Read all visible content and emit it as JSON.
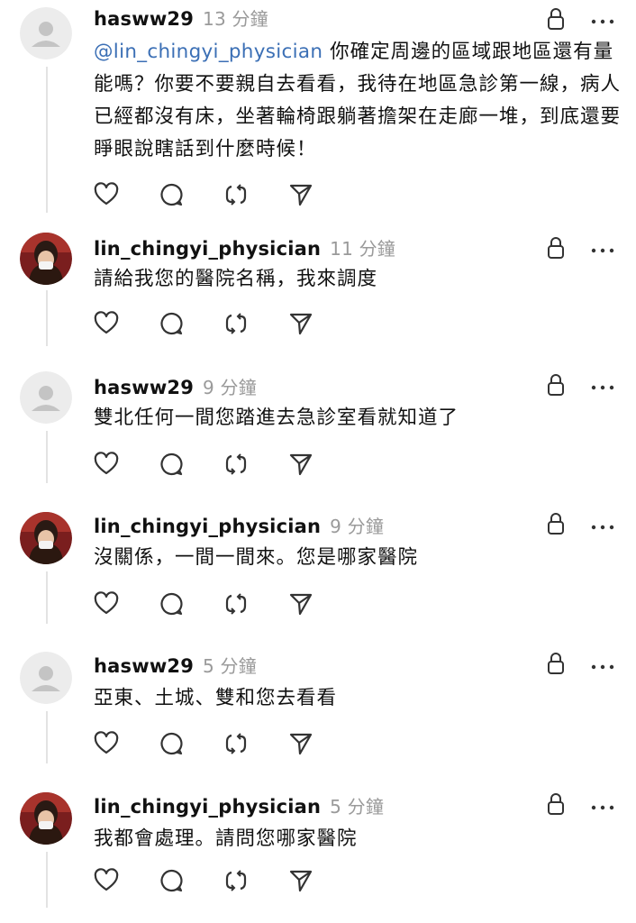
{
  "comments": [
    {
      "username": "hasww29",
      "time": "13 分鐘",
      "avatar": "default-avatar",
      "mention": "@lin_chingyi_physician",
      "text": " 你確定周邊的區域跟地區還有量能嗎？你要不要親自去看看，我待在地區急診第一線，病人已經都沒有床，坐著輪椅跟躺著擔架在走廊一堆，到底還要睜眼說瞎話到什麼時候！"
    },
    {
      "username": "lin_chingyi_physician",
      "time": "11 分鐘",
      "avatar": "photo-avatar",
      "text": "請給我您的醫院名稱，我來調度"
    },
    {
      "username": "hasww29",
      "time": "9 分鐘",
      "avatar": "default-avatar",
      "text": "雙北任何一間您踏進去急診室看就知道了"
    },
    {
      "username": "lin_chingyi_physician",
      "time": "9 分鐘",
      "avatar": "photo-avatar",
      "text": "沒關係，一間一間來。您是哪家醫院"
    },
    {
      "username": "hasww29",
      "time": "5 分鐘",
      "avatar": "default-avatar",
      "text": "亞東、土城、雙和您去看看"
    },
    {
      "username": "lin_chingyi_physician",
      "time": "5 分鐘",
      "avatar": "photo-avatar",
      "text": "我都會處理。請問您哪家醫院"
    }
  ],
  "icons": {
    "like": "heart-icon",
    "reply": "comment-icon",
    "repost": "repost-icon",
    "share": "send-icon",
    "lock": "lock-icon",
    "more": "more-icon"
  },
  "colors": {
    "mention": "#3b6fb5",
    "time": "#9a9a9a",
    "icon": "#333333",
    "thread_line": "#e3e3e3"
  }
}
